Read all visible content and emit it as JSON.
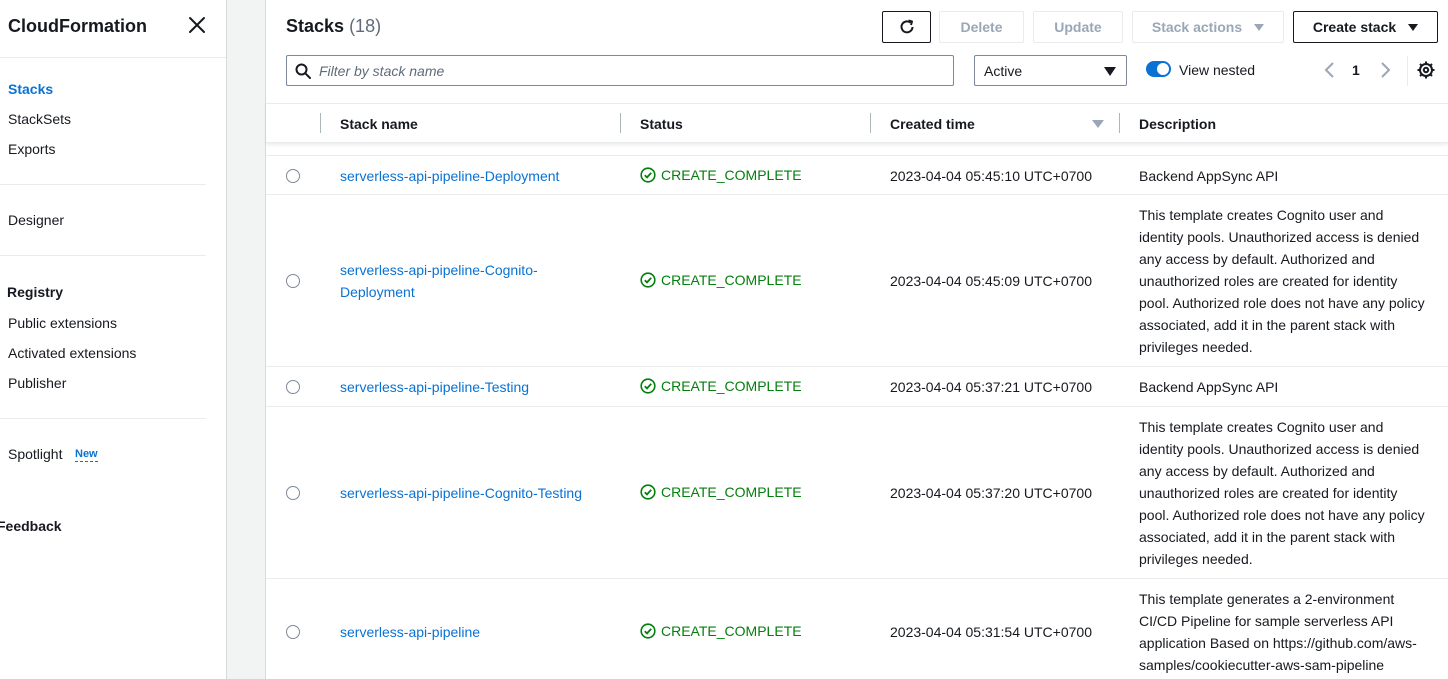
{
  "sidebar": {
    "title": "CloudFormation",
    "items": [
      {
        "label": "Stacks"
      },
      {
        "label": "StackSets"
      },
      {
        "label": "Exports"
      },
      {
        "label": "Designer"
      },
      {
        "label": "Public extensions"
      },
      {
        "label": "Activated extensions"
      },
      {
        "label": "Publisher"
      },
      {
        "label": "Spotlight"
      }
    ],
    "registry_heading": "Registry",
    "new_badge": "New",
    "feedback": "Feedback"
  },
  "header": {
    "title": "Stacks",
    "count": "(18)",
    "buttons": {
      "delete": "Delete",
      "update": "Update",
      "stack_actions": "Stack actions",
      "create_stack": "Create stack"
    }
  },
  "filter": {
    "placeholder": "Filter by stack name",
    "status_value": "Active",
    "view_nested_label": "View nested",
    "view_nested_on": true,
    "page": "1"
  },
  "table": {
    "columns": [
      "Stack name",
      "Status",
      "Created time",
      "Description"
    ],
    "rows": [
      {
        "name": "serverless-api-pipeline-Deployment",
        "status": "CREATE_COMPLETE",
        "created": "2023-04-04 05:45:10 UTC+0700",
        "description": "Backend AppSync API"
      },
      {
        "name": "serverless-api-pipeline-Cognito-Deployment",
        "status": "CREATE_COMPLETE",
        "created": "2023-04-04 05:45:09 UTC+0700",
        "description": "This template creates Cognito user and identity pools. Unauthorized access is denied any access by default. Authorized and unauthorized roles are created for identity pool. Authorized role does not have any policy associated, add it in the parent stack with privileges needed."
      },
      {
        "name": "serverless-api-pipeline-Testing",
        "status": "CREATE_COMPLETE",
        "created": "2023-04-04 05:37:21 UTC+0700",
        "description": "Backend AppSync API"
      },
      {
        "name": "serverless-api-pipeline-Cognito-Testing",
        "status": "CREATE_COMPLETE",
        "created": "2023-04-04 05:37:20 UTC+0700",
        "description": "This template creates Cognito user and identity pools. Unauthorized access is denied any access by default. Authorized and unauthorized roles are created for identity pool. Authorized role does not have any policy associated, add it in the parent stack with privileges needed."
      },
      {
        "name": "serverless-api-pipeline",
        "status": "CREATE_COMPLETE",
        "created": "2023-04-04 05:31:54 UTC+0700",
        "description": "This template generates a 2-environment CI/CD Pipeline for sample serverless API application Based on https://github.com/aws-samples/cookiecutter-aws-sam-pipeline"
      }
    ]
  },
  "colors": {
    "link": "#0972d3",
    "success": "#037f0c",
    "text": "#16191f"
  },
  "icons": {
    "close": "close-icon",
    "refresh": "refresh-icon",
    "search": "search-icon",
    "settings": "gear-icon",
    "status": "success-check-icon"
  }
}
